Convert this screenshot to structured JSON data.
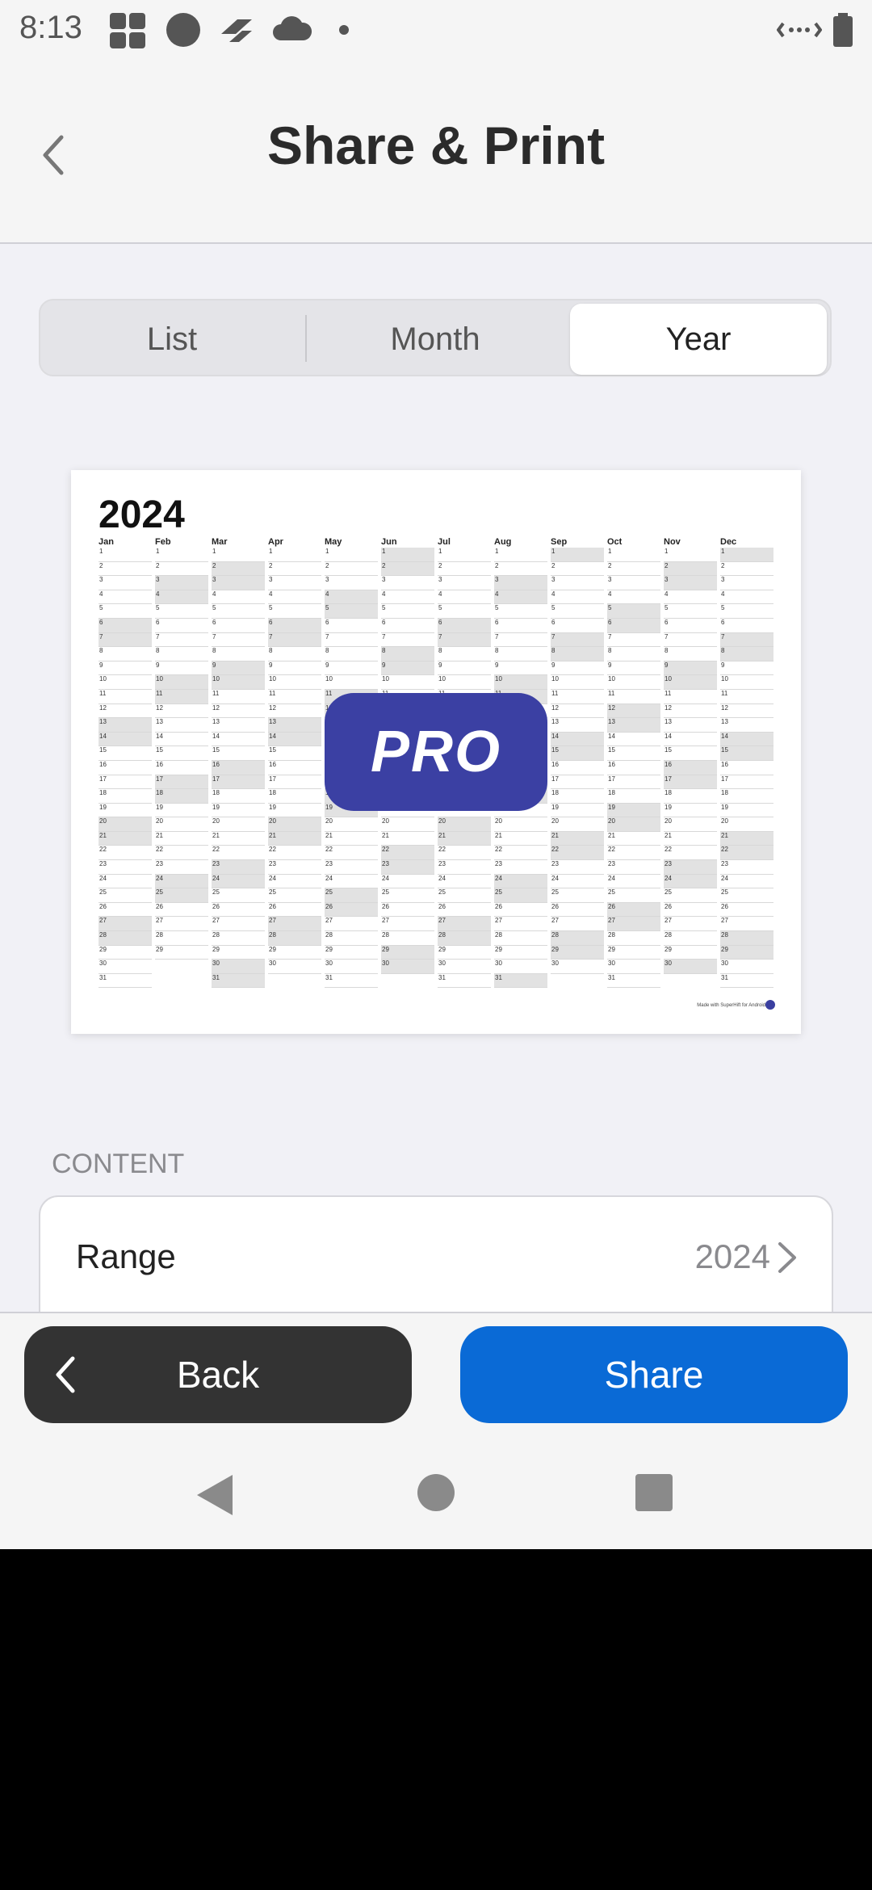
{
  "status_bar": {
    "time": "8:13"
  },
  "header": {
    "title": "Share & Print"
  },
  "tabs": [
    {
      "label": "List",
      "active": false
    },
    {
      "label": "Month",
      "active": false
    },
    {
      "label": "Year",
      "active": true
    }
  ],
  "preview": {
    "year": "2024",
    "months": [
      "Jan",
      "Feb",
      "Mar",
      "Apr",
      "May",
      "Jun",
      "Jul",
      "Aug",
      "Sep",
      "Oct",
      "Nov",
      "Dec"
    ],
    "badge": "PRO",
    "footer_text": "Made with SuperHift for Android"
  },
  "content": {
    "section_label": "CONTENT",
    "rows": [
      {
        "label": "Range",
        "value": "2024"
      }
    ]
  },
  "actions": {
    "back_label": "Back",
    "share_label": "Share"
  },
  "colors": {
    "accent": "#0a6ad6",
    "pro_badge": "#3b40a3",
    "back_button": "#333333"
  }
}
